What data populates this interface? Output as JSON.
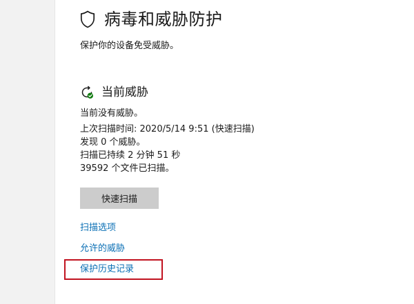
{
  "header": {
    "title": "病毒和威胁防护",
    "subtitle": "保护你的设备免受威胁。"
  },
  "current_threats": {
    "title": "当前威胁",
    "status": "当前没有威胁。",
    "details": [
      "上次扫描时间: 2020/5/14 9:51 (快速扫描)",
      "发现 0 个威胁。",
      "扫描已持续 2 分钟 51 秒",
      "39592 个文件已扫描。"
    ],
    "scan_button_label": "快速扫描"
  },
  "links": {
    "scan_options": "扫描选项",
    "allowed_threats": "允许的威胁",
    "protection_history": "保护历史记录"
  },
  "icons": {
    "header": "shield-icon",
    "section": "refresh-check-icon"
  },
  "colors": {
    "link": "#0a6fb5",
    "highlight": "#c1121f",
    "button_bg": "#cccccc",
    "status_ok": "#107c10"
  }
}
